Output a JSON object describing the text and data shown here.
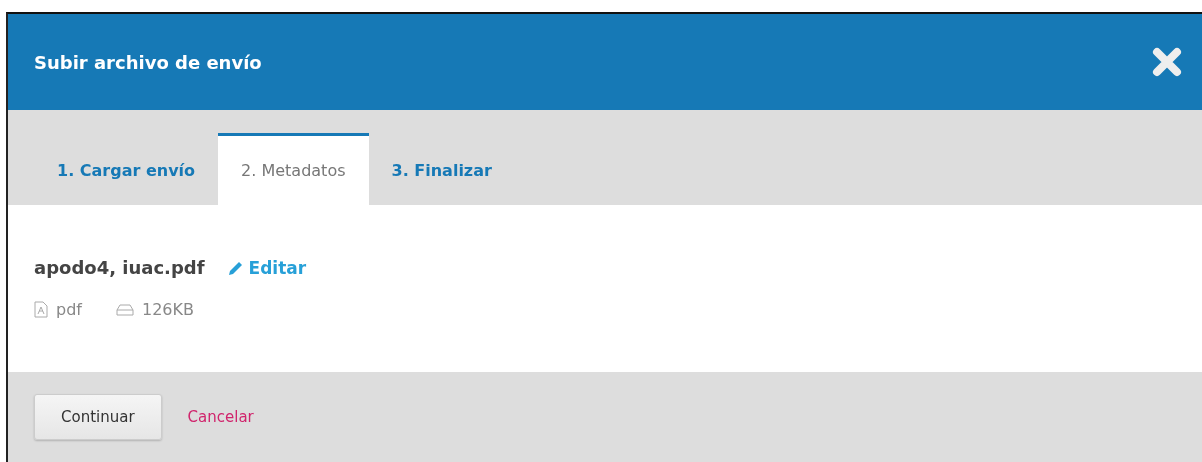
{
  "window": {
    "title": "Subir archivo de envío"
  },
  "tabs": [
    {
      "label": "1. Cargar envío",
      "selected": false
    },
    {
      "label": "2. Metadatos",
      "selected": true
    },
    {
      "label": "3. Finalizar",
      "selected": false
    }
  ],
  "file": {
    "name": "apodo4, iuac.pdf",
    "edit_link": "Editar",
    "type": "pdf",
    "size": "126KB"
  },
  "buttons": {
    "primary": "Continuar",
    "cancel": "Cancelar"
  }
}
